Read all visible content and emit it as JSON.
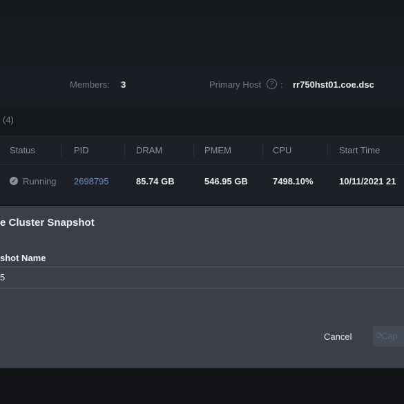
{
  "summary": {
    "members_label": "Members:",
    "members_value": "3",
    "primary_host_label": "Primary Host",
    "primary_host_separator": ":",
    "primary_host_value": "rr750hst01.coe.dsc"
  },
  "processes_count": "(4)",
  "table": {
    "columns": [
      "Status",
      "PID",
      "DRAM",
      "PMEM",
      "CPU",
      "Start Time"
    ],
    "rows": [
      {
        "status": "Running",
        "pid": "2698795",
        "dram": "85.74 GB",
        "pmem": "546.95 GB",
        "cpu": "7498.10%",
        "start_time": "10/11/2021 21"
      }
    ]
  },
  "modal": {
    "title": "e Cluster Snapshot",
    "field_label": "shot Name",
    "field_value": "5",
    "cancel_label": "Cancel",
    "capture_label": "Cap"
  }
}
